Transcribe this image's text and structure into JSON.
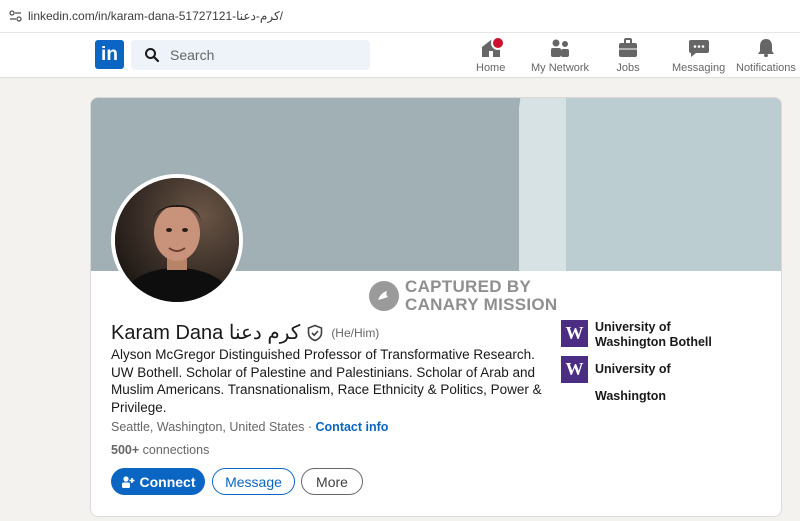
{
  "browser": {
    "url": "linkedin.com/in/karam-dana-51727121-كرم-دعنا/"
  },
  "nav": {
    "search_placeholder": "Search",
    "items": [
      {
        "label": "Home",
        "icon": "home-icon"
      },
      {
        "label": "My Network",
        "icon": "network-icon"
      },
      {
        "label": "Jobs",
        "icon": "briefcase-icon"
      },
      {
        "label": "Messaging",
        "icon": "messaging-icon"
      },
      {
        "label": "Notifications",
        "icon": "bell-icon"
      }
    ]
  },
  "profile": {
    "name": "Karam Dana كرم دعنا",
    "pronouns": "(He/Him)",
    "headline": "Alyson McGregor Distinguished Professor of Transformative Research. UW Bothell. Scholar of Palestine and Palestinians. Scholar of Arab and Muslim Americans. Transnationalism, Race Ethnicity & Politics, Power & Privilege.",
    "location": "Seattle, Washington, United States",
    "separator": " · ",
    "contact_info": "Contact info",
    "connections_count": "500+",
    "connections_label": " connections",
    "education": [
      {
        "name": "University of Washington Bothell",
        "logo": "W"
      },
      {
        "name": "University of Washington",
        "logo": "W"
      }
    ]
  },
  "actions": {
    "connect": "Connect",
    "message": "Message",
    "more": "More"
  },
  "watermark": {
    "line1": "CAPTURED BY",
    "line2": "CANARY MISSION"
  },
  "colors": {
    "brand": "#0a66c2",
    "uw_purple": "#4b2e83",
    "banner": "#a1b0b5"
  }
}
